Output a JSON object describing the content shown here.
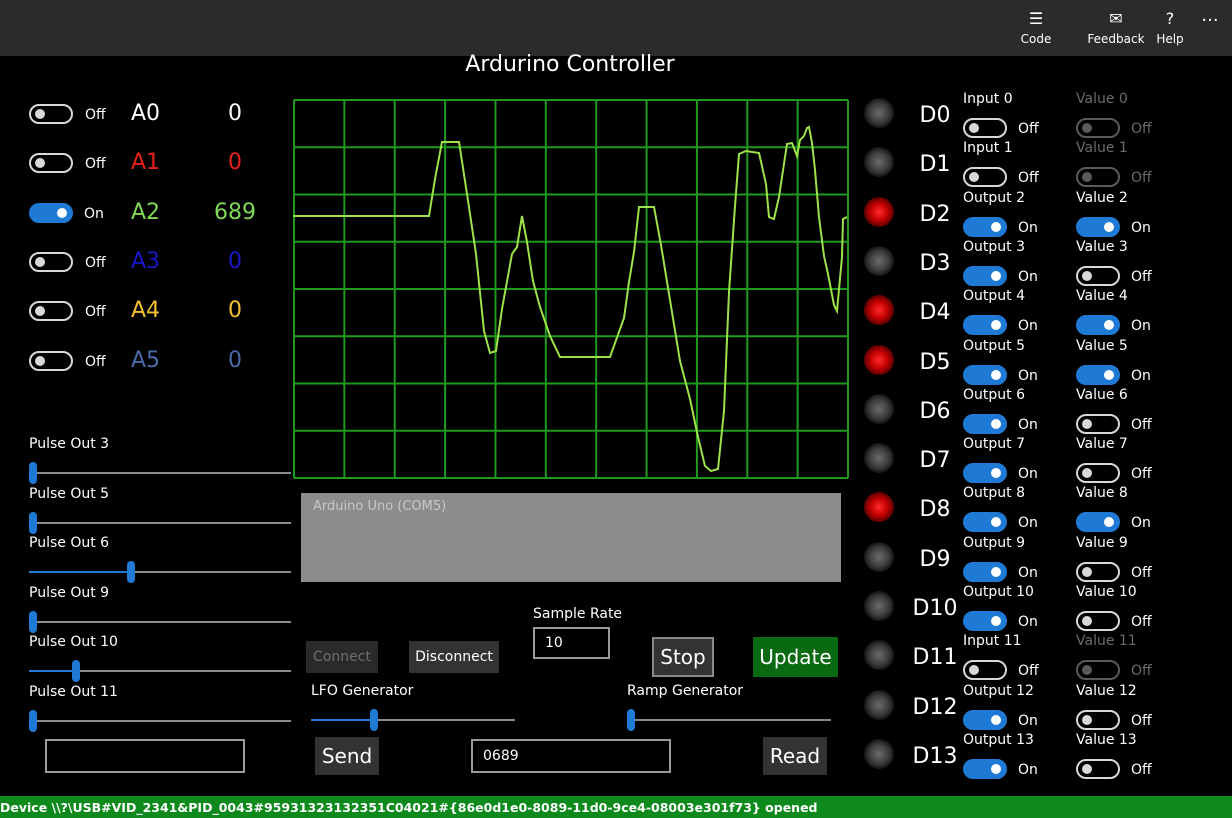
{
  "titlebar": {
    "code_label": "Code",
    "feedback_label": "Feedback",
    "help_label": "Help",
    "more_label": "···"
  },
  "app_title": "Ardurino Controller",
  "analog": [
    {
      "toggle": "Off",
      "name": "A0",
      "value": "0",
      "color": "#ffffff",
      "on": false
    },
    {
      "toggle": "Off",
      "name": "A1",
      "value": "0",
      "color": "#e8201c",
      "on": false
    },
    {
      "toggle": "On",
      "name": "A2",
      "value": "689",
      "color": "#7ed957",
      "on": true
    },
    {
      "toggle": "Off",
      "name": "A3",
      "value": "0",
      "color": "#1818c8",
      "on": false
    },
    {
      "toggle": "Off",
      "name": "A4",
      "value": "0",
      "color": "#f0c030",
      "on": false
    },
    {
      "toggle": "Off",
      "name": "A5",
      "value": "0",
      "color": "#4a6aa8",
      "on": false
    }
  ],
  "pulse_outs": [
    {
      "label": "Pulse Out 3",
      "level": 0.01
    },
    {
      "label": "Pulse Out 5",
      "level": 0.01
    },
    {
      "label": "Pulse Out 6",
      "level": 0.39
    },
    {
      "label": "Pulse Out 9",
      "level": 0.01
    },
    {
      "label": "Pulse Out 10",
      "level": 0.18
    },
    {
      "label": "Pulse Out 11",
      "level": 0.01
    }
  ],
  "scope": {
    "grid_color": "#1f9a1f",
    "trace_color": "#9ee24a"
  },
  "output_text": "Arduino Uno (COM5)",
  "buttons": {
    "connect": "Connect",
    "disconnect": "Disconnect",
    "stop": "Stop",
    "update": "Update",
    "send": "Send",
    "read": "Read"
  },
  "sample_rate": {
    "label": "Sample Rate",
    "value": "10"
  },
  "lfo": {
    "label": "LFO Generator",
    "level": 0.31
  },
  "ramp": {
    "label": "Ramp Generator",
    "level": 0.0
  },
  "send_text": "",
  "read_text": "0689",
  "digital": [
    {
      "name": "D0",
      "led": "off",
      "mode": "Input 0",
      "mode_toggle": "Off",
      "mode_on": false,
      "value": "Value 0",
      "value_toggle": "Off",
      "value_on": false,
      "value_disabled": true
    },
    {
      "name": "D1",
      "led": "off",
      "mode": "Input 1",
      "mode_toggle": "Off",
      "mode_on": false,
      "value": "Value 1",
      "value_toggle": "Off",
      "value_on": false,
      "value_disabled": true
    },
    {
      "name": "D2",
      "led": "red",
      "mode": "Output 2",
      "mode_toggle": "On",
      "mode_on": true,
      "value": "Value 2",
      "value_toggle": "On",
      "value_on": true,
      "value_disabled": false
    },
    {
      "name": "D3",
      "led": "off",
      "mode": "Output 3",
      "mode_toggle": "On",
      "mode_on": true,
      "value": "Value 3",
      "value_toggle": "Off",
      "value_on": false,
      "value_disabled": false
    },
    {
      "name": "D4",
      "led": "red",
      "mode": "Output 4",
      "mode_toggle": "On",
      "mode_on": true,
      "value": "Value 4",
      "value_toggle": "On",
      "value_on": true,
      "value_disabled": false
    },
    {
      "name": "D5",
      "led": "red",
      "mode": "Output 5",
      "mode_toggle": "On",
      "mode_on": true,
      "value": "Value 5",
      "value_toggle": "On",
      "value_on": true,
      "value_disabled": false
    },
    {
      "name": "D6",
      "led": "off",
      "mode": "Output 6",
      "mode_toggle": "On",
      "mode_on": true,
      "value": "Value 6",
      "value_toggle": "Off",
      "value_on": false,
      "value_disabled": false
    },
    {
      "name": "D7",
      "led": "off",
      "mode": "Output 7",
      "mode_toggle": "On",
      "mode_on": true,
      "value": "Value 7",
      "value_toggle": "Off",
      "value_on": false,
      "value_disabled": false
    },
    {
      "name": "D8",
      "led": "red",
      "mode": "Output 8",
      "mode_toggle": "On",
      "mode_on": true,
      "value": "Value 8",
      "value_toggle": "On",
      "value_on": true,
      "value_disabled": false
    },
    {
      "name": "D9",
      "led": "off",
      "mode": "Output 9",
      "mode_toggle": "On",
      "mode_on": true,
      "value": "Value 9",
      "value_toggle": "Off",
      "value_on": false,
      "value_disabled": false
    },
    {
      "name": "D10",
      "led": "off",
      "mode": "Output 10",
      "mode_toggle": "On",
      "mode_on": true,
      "value": "Value 10",
      "value_toggle": "Off",
      "value_on": false,
      "value_disabled": false
    },
    {
      "name": "D11",
      "led": "off",
      "mode": "Input 11",
      "mode_toggle": "Off",
      "mode_on": false,
      "value": "Value 11",
      "value_toggle": "Off",
      "value_on": false,
      "value_disabled": true
    },
    {
      "name": "D12",
      "led": "off",
      "mode": "Output 12",
      "mode_toggle": "On",
      "mode_on": true,
      "value": "Value 12",
      "value_toggle": "Off",
      "value_on": false,
      "value_disabled": false
    },
    {
      "name": "D13",
      "led": "off",
      "mode": "Output 13",
      "mode_toggle": "On",
      "mode_on": true,
      "value": "Value 13",
      "value_toggle": "Off",
      "value_on": false,
      "value_disabled": false
    }
  ],
  "status": "Device \\\\?\\USB#VID_2341&PID_0043#95931323132351C04021#{86e0d1e0-8089-11d0-9ce4-08003e301f73} opened"
}
